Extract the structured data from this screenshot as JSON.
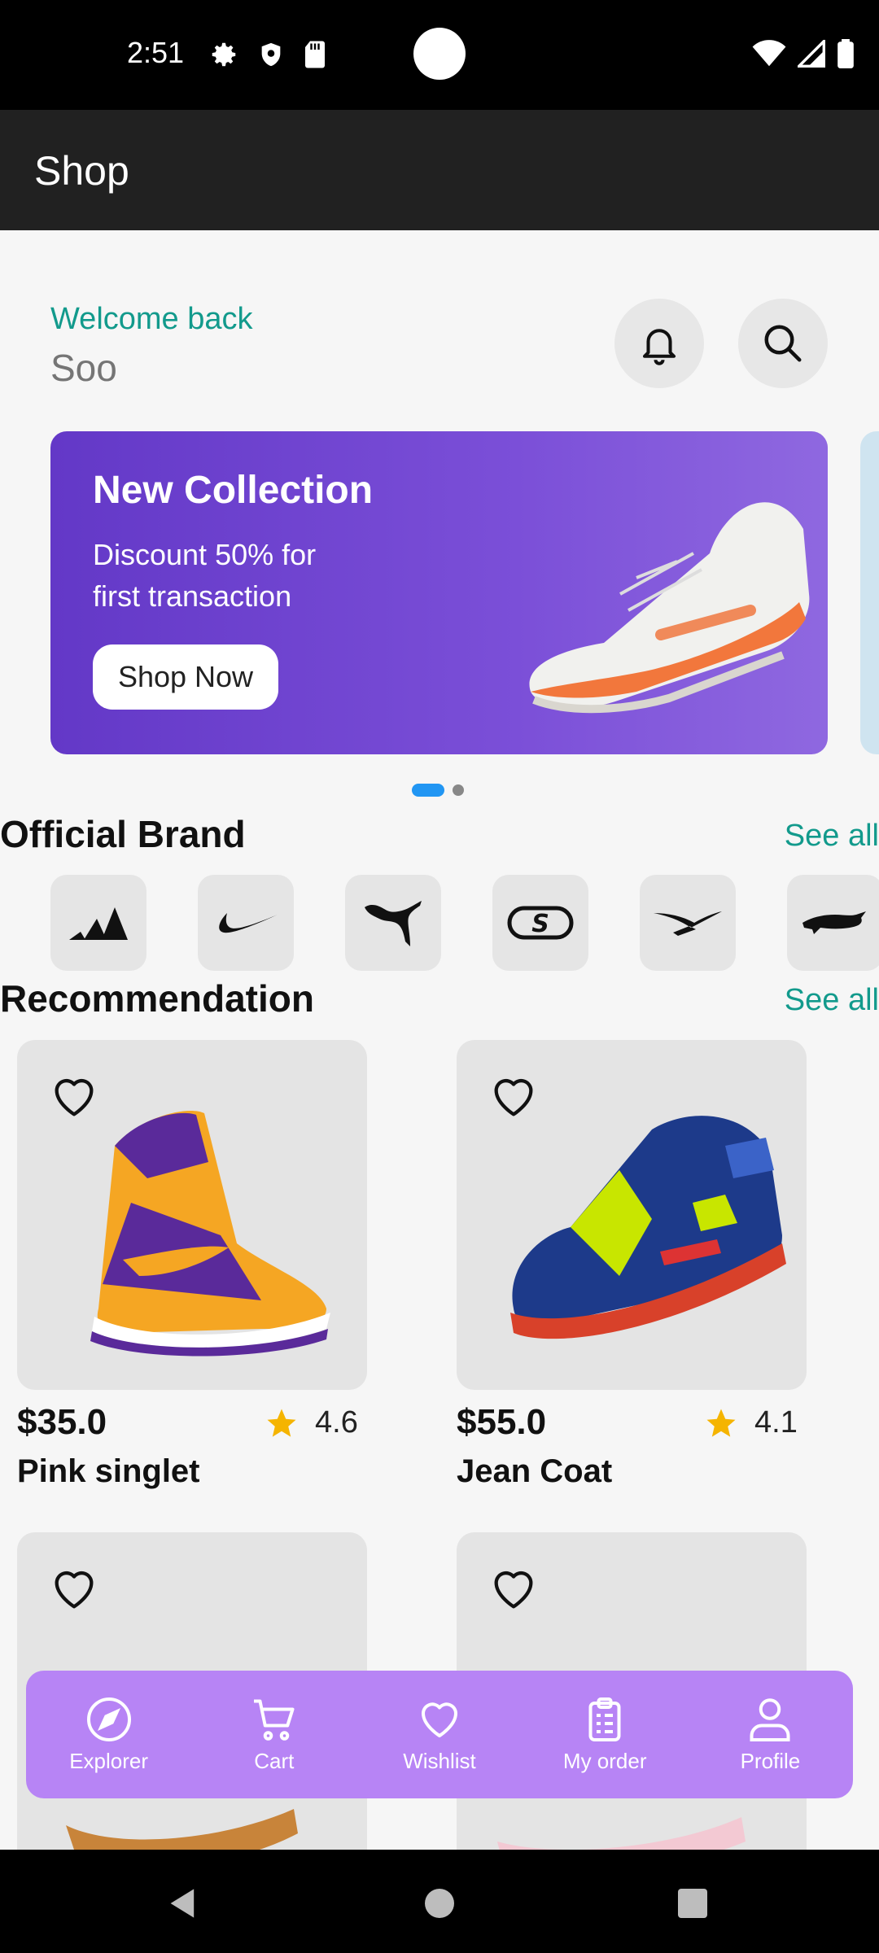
{
  "status_bar": {
    "time": "2:51"
  },
  "app_bar": {
    "title": "Shop"
  },
  "greeting": {
    "welcome": "Welcome back",
    "username": "Soo"
  },
  "banner": {
    "title": "New Collection",
    "subtitle": "Discount 50% for first transaction",
    "button": "Shop Now"
  },
  "sections": {
    "brands": {
      "title": "Official Brand",
      "see_all": "See all"
    },
    "recommendation": {
      "title": "Recommendation",
      "see_all": "See all"
    }
  },
  "brands": [
    "adidas",
    "nike",
    "puma",
    "skechers",
    "reebok",
    "lacoste"
  ],
  "products": [
    {
      "price": "$35.0",
      "rating": "4.6",
      "name": "Pink singlet"
    },
    {
      "price": "$55.0",
      "rating": "4.1",
      "name": "Jean Coat"
    }
  ],
  "bottom_nav": [
    {
      "label": "Explorer",
      "icon": "compass-icon"
    },
    {
      "label": "Cart",
      "icon": "cart-icon"
    },
    {
      "label": "Wishlist",
      "icon": "heart-icon"
    },
    {
      "label": "My order",
      "icon": "clipboard-icon"
    },
    {
      "label": "Profile",
      "icon": "person-icon"
    }
  ],
  "colors": {
    "accent_teal": "#129a8c",
    "banner_purple": "#6d44d0",
    "nav_purple": "#b784f5",
    "dot_blue": "#2196f3",
    "star": "#f5b400"
  }
}
